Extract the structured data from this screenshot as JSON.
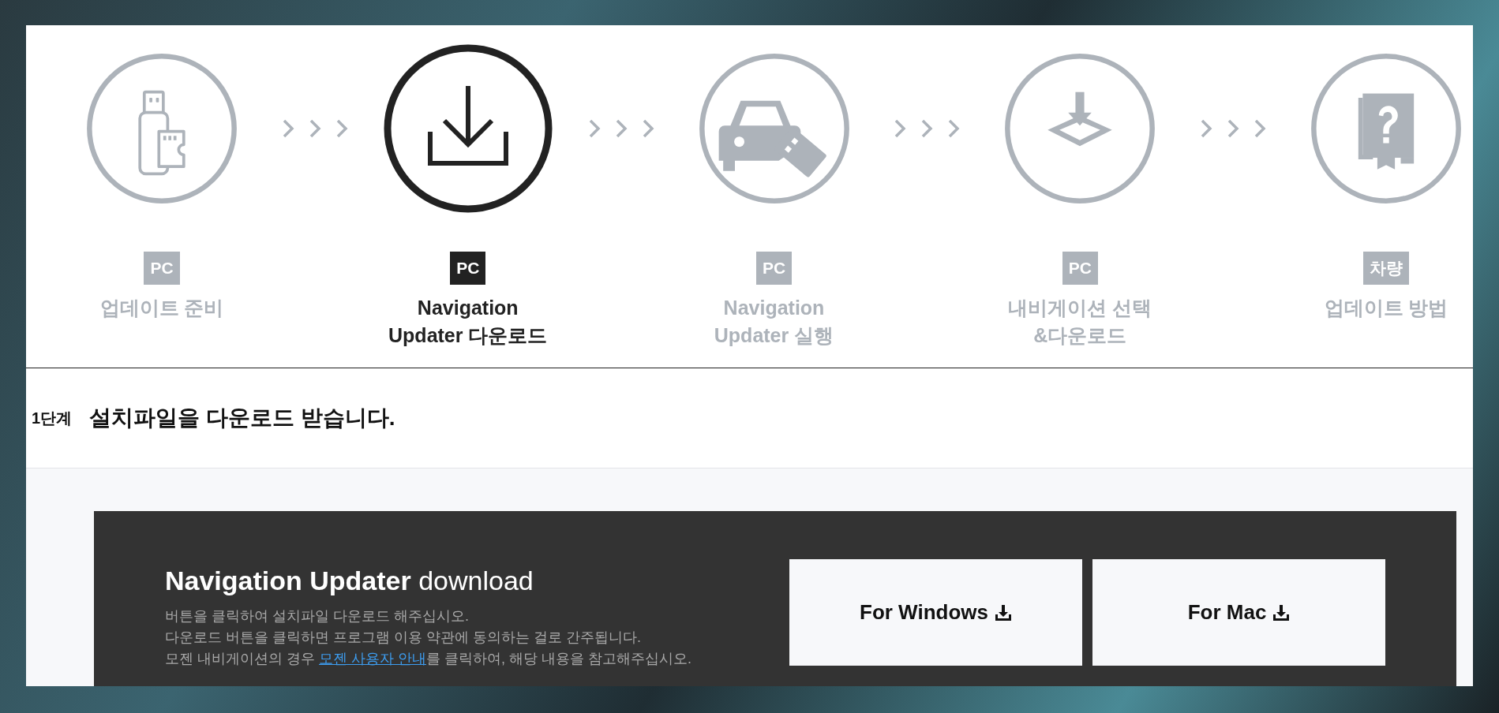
{
  "steps": [
    {
      "kind": "usb",
      "badge": "PC",
      "label_lines": [
        "업데이트 준비"
      ],
      "selected": false
    },
    {
      "kind": "download",
      "badge": "PC",
      "label_lines": [
        "Navigation",
        "Updater 다운로드"
      ],
      "selected": true
    },
    {
      "kind": "car",
      "badge": "PC",
      "label_lines": [
        "Navigation",
        "Updater 실행"
      ],
      "selected": false
    },
    {
      "kind": "map",
      "badge": "PC",
      "label_lines": [
        "내비게이션 선택",
        "&다운로드"
      ],
      "selected": false
    },
    {
      "kind": "book",
      "badge": "차량",
      "label_lines": [
        "업데이트 방법"
      ],
      "selected": false
    }
  ],
  "step_heading": {
    "number": "1단계",
    "title": "설치파일을 다운로드 받습니다."
  },
  "download": {
    "title": "**Navigation Updater** download",
    "lines": [
      "버튼을 클릭하여 설치파일 다운로드 해주십시오.",
      "다운로드 버튼을 클릭하면 프로그램 이용 약관에 동의하는 걸로 간주됩니다."
    ],
    "notice": {
      "before": "모젠 내비게이션의 경우 ",
      "link": "모젠 사용자 안내",
      "after": "를 클릭하여, 해당 내용을 참고해주십시오."
    },
    "buttons": [
      "For Windows",
      "For Mac"
    ]
  }
}
